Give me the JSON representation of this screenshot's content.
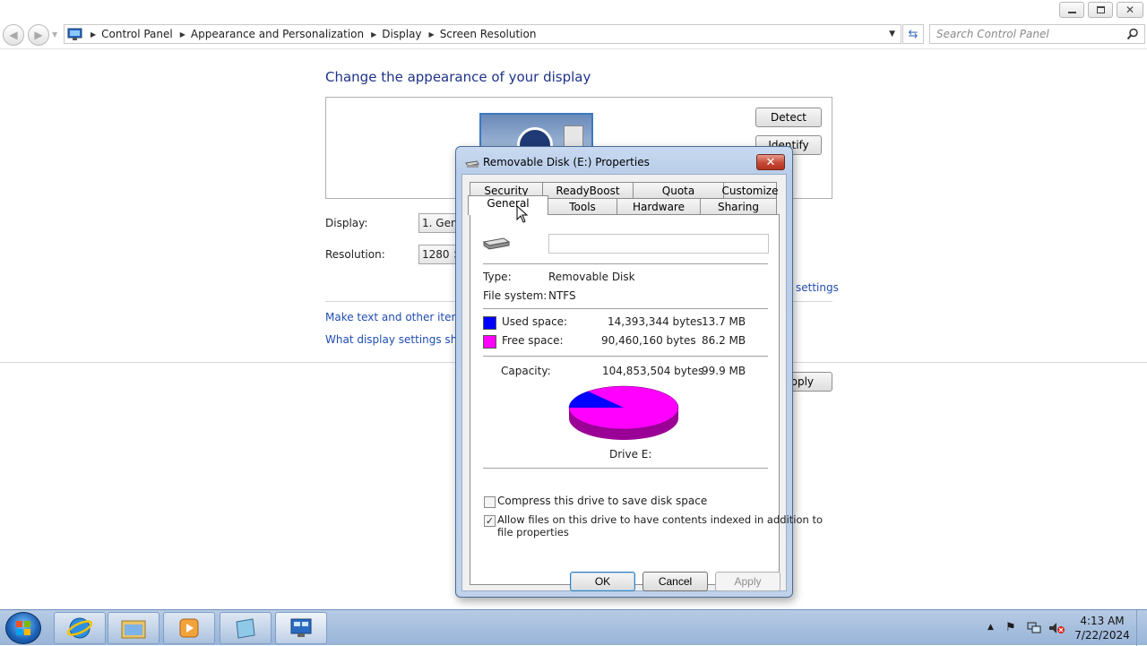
{
  "window": {
    "breadcrumbs": [
      "Control Panel",
      "Appearance and Personalization",
      "Display",
      "Screen Resolution"
    ],
    "search_placeholder": "Search Control Panel"
  },
  "main": {
    "heading": "Change the appearance of your display",
    "detect_label": "Detect",
    "identify_label": "Identify",
    "display_label": "Display:",
    "display_value": "1. Gene",
    "resolution_label": "Resolution:",
    "resolution_value": "1280 ×",
    "advanced_link": "settings",
    "link_text_size": "Make text and other items la",
    "link_display_settings": "What display settings shoul",
    "apply_partial": "pply"
  },
  "dialog": {
    "title": "Removable Disk (E:) Properties",
    "close_glyph": "✕",
    "tabs_top": [
      "Security",
      "ReadyBoost",
      "Quota",
      "Customize"
    ],
    "tabs_bottom": [
      "General",
      "Tools",
      "Hardware",
      "Sharing"
    ],
    "active_tab": "General",
    "volume_name": "",
    "type_label": "Type:",
    "type_value": "Removable Disk",
    "fs_label": "File system:",
    "fs_value": "NTFS",
    "used_label": "Used space:",
    "used_bytes": "14,393,344 bytes",
    "used_size": "13.7 MB",
    "free_label": "Free space:",
    "free_bytes": "90,460,160 bytes",
    "free_size": "86.2 MB",
    "capacity_label": "Capacity:",
    "capacity_bytes": "104,853,504 bytes",
    "capacity_size": "99.9 MB",
    "drive_label": "Drive E:",
    "used_fraction": 0.137,
    "used_color": "#0000ff",
    "free_color": "#ff00ff",
    "compress_label": "Compress this drive to save disk space",
    "compress_checked": false,
    "index_label_1": "Allow files on this drive to have contents indexed in addition to",
    "index_label_2": "file properties",
    "index_checked": true,
    "ok_label": "OK",
    "cancel_label": "Cancel",
    "apply_label": "Apply"
  },
  "taskbar": {
    "time": "4:13 AM",
    "date": "7/22/2024",
    "tray_icons": [
      "show-hidden-icons-arrow",
      "action-center-flag-icon",
      "network-icon",
      "volume-muted-icon"
    ],
    "apps": [
      "internet-explorer-icon",
      "windows-explorer-icon",
      "media-player-icon",
      "notepad-icon",
      "control-panel-icon"
    ]
  }
}
